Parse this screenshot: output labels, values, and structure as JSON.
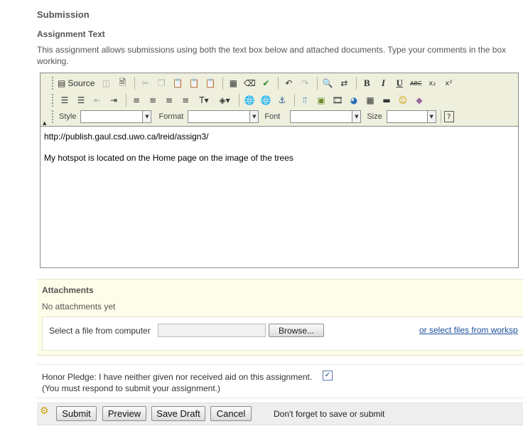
{
  "section": {
    "title": "Submission"
  },
  "assignment": {
    "title": "Assignment Text",
    "instructions_line1": "This assignment allows submissions using both the text box below and attached documents. Type your comments in the box",
    "instructions_line2": "working."
  },
  "editor": {
    "source_label": "Source",
    "style_label": "Style",
    "format_label": "Format",
    "font_label": "Font",
    "size_label": "Size",
    "style_value": "",
    "format_value": "",
    "font_value": "",
    "size_value": "",
    "content_line1": "http://publish.gaul.csd.uwo.ca/lreid/assign3/",
    "content_line2": "My hotspot is located on the Home page on the image of the trees"
  },
  "attachments": {
    "title": "Attachments",
    "empty_text": "No attachments yet",
    "select_label": "Select a file from computer",
    "file_value": "",
    "browse_label": "Browse...",
    "workspace_link": "or select files from worksp"
  },
  "honor": {
    "pledge": "Honor Pledge: I have neither given nor received aid on this assignment.",
    "checked": true,
    "note": "(You must respond to submit your assignment.)"
  },
  "actions": {
    "submit": "Submit",
    "preview": "Preview",
    "save_draft": "Save Draft",
    "cancel": "Cancel",
    "reminder": "Don't forget to save or submit"
  },
  "icons": {
    "bold_glyph": "B",
    "italic_glyph": "I",
    "underline_glyph": "U",
    "strike_glyph": "ABC",
    "subscript_glyph": "x₂",
    "superscript_glyph": "x²"
  },
  "colors": {
    "link": "#1b4f9c",
    "attach_bg": "#fdfde9",
    "toolbar_bg": "#efefde"
  }
}
